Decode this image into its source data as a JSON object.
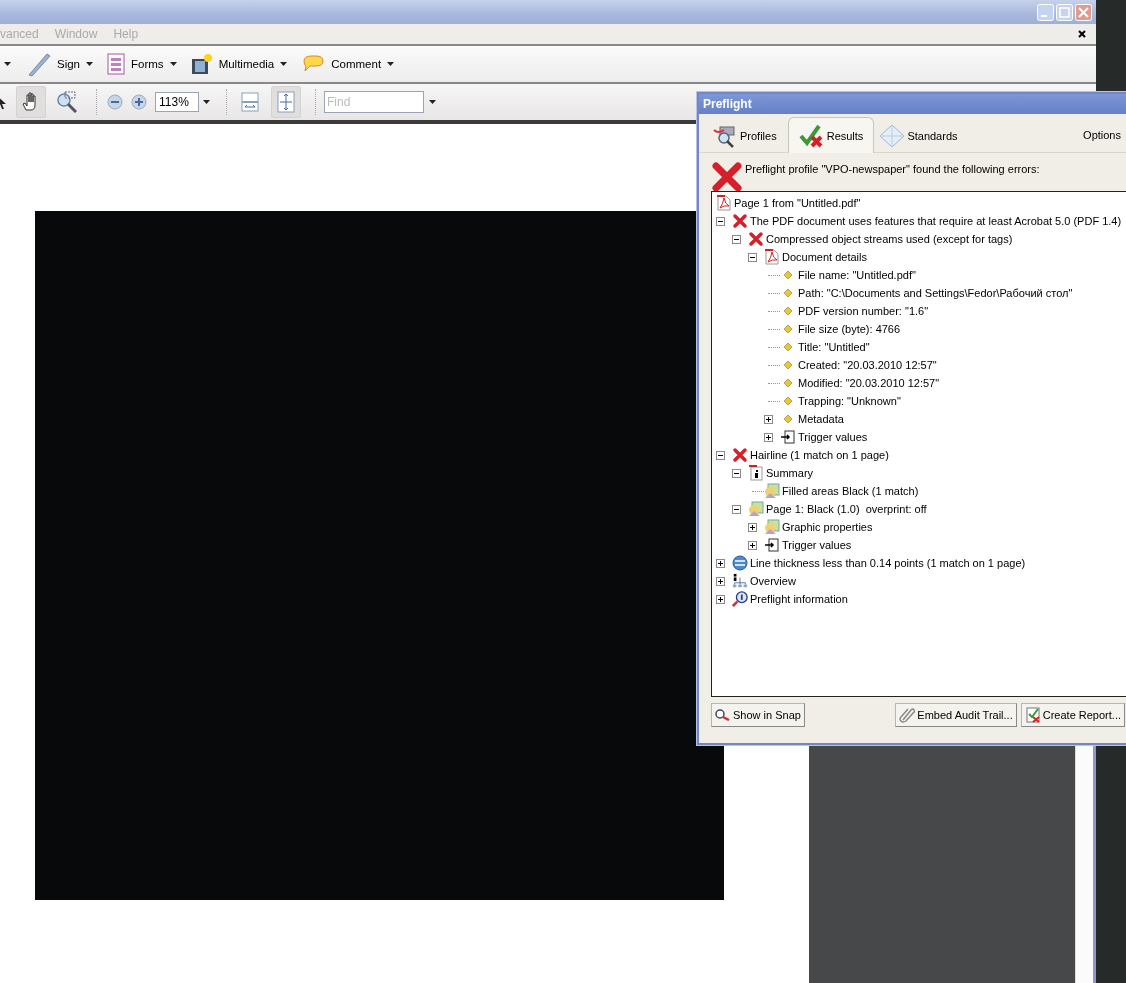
{
  "acrobat": {
    "menu": [
      "vanced",
      "Window",
      "Help"
    ],
    "task_buttons": [
      {
        "label": "Sign"
      },
      {
        "label": "Forms"
      },
      {
        "label": "Multimedia"
      },
      {
        "label": "Comment"
      }
    ],
    "nav_tools": [
      {
        "selected": false
      },
      {
        "selected": true
      },
      {
        "selected": false
      }
    ],
    "zoom_value": "113%",
    "view_tools": [
      {
        "selected": false
      },
      {
        "selected": true
      }
    ],
    "find": {
      "placeholder": "Find"
    }
  },
  "preflight": {
    "title": "Preflight",
    "tabs": [
      {
        "label": "Profiles",
        "selected": false
      },
      {
        "label": "Results",
        "selected": true
      },
      {
        "label": "Standards",
        "selected": false
      }
    ],
    "options": "Options",
    "message": "Preflight profile \"VPO-newspaper\" found the following errors:",
    "tree": [
      {
        "label": "Page 1 from \"Untitled.pdf\"",
        "kind": "pdf"
      },
      {
        "label": "The PDF document uses features that require at least Acrobat 5.0 (PDF 1.4)",
        "kind": "error",
        "expanded": true,
        "children": [
          {
            "label": "Compressed object streams used (except for tags)",
            "kind": "error",
            "expanded": true,
            "children": [
              {
                "label": "Document details",
                "kind": "pdf",
                "expanded": true,
                "children": [
                  {
                    "label": "File name: \"Untitled.pdf\"",
                    "kind": "bullet"
                  },
                  {
                    "label": "Path: \"C:\\Documents and Settings\\Fedor\\Рабочий стол\"",
                    "kind": "bullet"
                  },
                  {
                    "label": "PDF version number: \"1.6\"",
                    "kind": "bullet"
                  },
                  {
                    "label": "File size (byte): 4766",
                    "kind": "bullet"
                  },
                  {
                    "label": "Title: \"Untitled\"",
                    "kind": "bullet"
                  },
                  {
                    "label": "Created: \"20.03.2010 12:57\"",
                    "kind": "bullet"
                  },
                  {
                    "label": "Modified: \"20.03.2010 12:57\"",
                    "kind": "bullet"
                  },
                  {
                    "label": "Trapping: \"Unknown\"",
                    "kind": "bullet"
                  },
                  {
                    "label": "Metadata",
                    "kind": "bullet",
                    "expanded": false
                  },
                  {
                    "label": "Trigger values",
                    "kind": "trigger",
                    "expanded": false
                  }
                ]
              }
            ]
          }
        ]
      },
      {
        "label": "Hairline (1 match on 1 page)",
        "kind": "error",
        "expanded": true,
        "children": [
          {
            "label": "Summary",
            "kind": "summary",
            "expanded": true,
            "children": [
              {
                "label": "Filled areas Black (1 match)",
                "kind": "graphic"
              }
            ]
          },
          {
            "label": "Page 1: Black (1.0)  overprint: off",
            "kind": "graphic",
            "expanded": true,
            "children": [
              {
                "label": "Graphic properties",
                "kind": "graphic",
                "expanded": false
              },
              {
                "label": "Trigger values",
                "kind": "trigger",
                "expanded": false
              }
            ]
          }
        ]
      },
      {
        "label": "Line thickness less than 0.14 points (1 match on 1 page)",
        "kind": "globe",
        "expanded": false
      },
      {
        "label": "Overview",
        "kind": "overview",
        "expanded": false
      },
      {
        "label": "Preflight information",
        "kind": "info",
        "expanded": false
      }
    ],
    "buttons": [
      "Show in Snap",
      "Embed Audit Trail...",
      "Create Report..."
    ]
  }
}
